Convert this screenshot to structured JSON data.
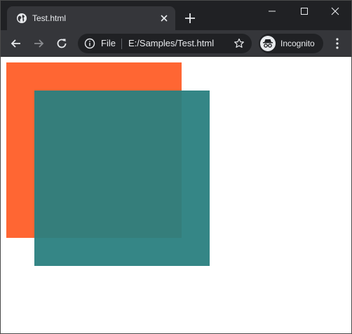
{
  "tab": {
    "title": "Test.html",
    "favicon": "globe-icon"
  },
  "toolbar": {
    "back": "back-arrow-icon",
    "forward": "forward-arrow-icon",
    "reload": "reload-icon"
  },
  "omnibox": {
    "scheme": "File",
    "url": "E:/Samples/Test.html",
    "bookmark": "star-icon"
  },
  "profile": {
    "label": "Incognito",
    "icon": "incognito-icon"
  },
  "colors": {
    "tabstrip": "#202124",
    "toolbar": "#35363a",
    "orange_square": "#ff6633",
    "teal_square": "#2a7f7f",
    "teal_opacity": 0.95
  }
}
